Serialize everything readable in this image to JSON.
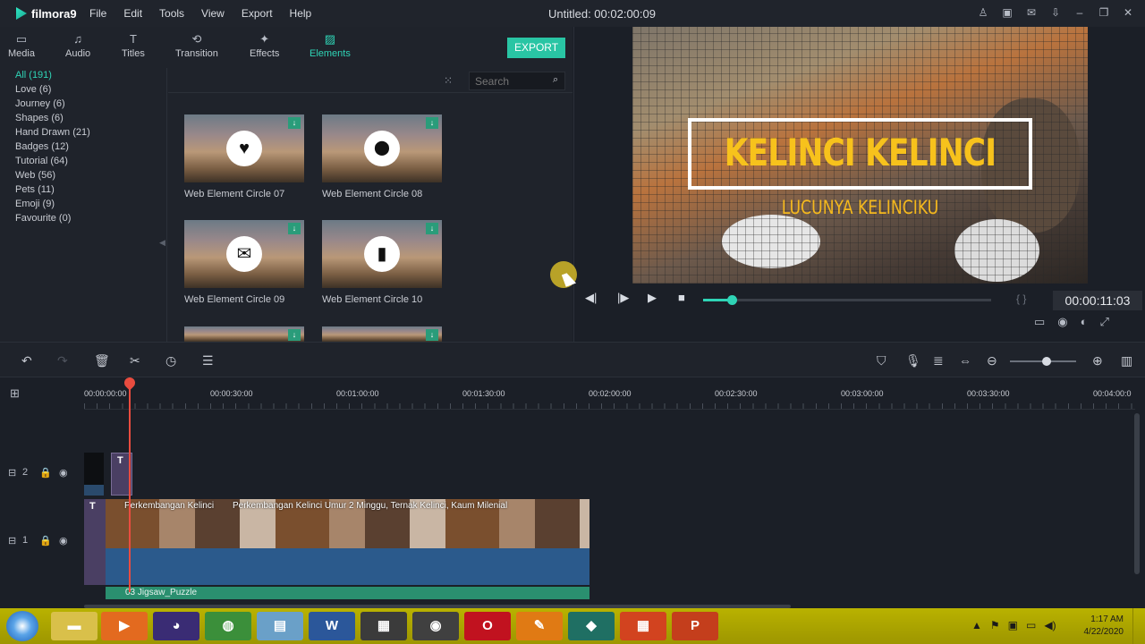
{
  "app": {
    "name": "filmora9",
    "menu": [
      "File",
      "Edit",
      "Tools",
      "View",
      "Export",
      "Help"
    ],
    "title": "Untitled:  00:02:00:09"
  },
  "tabs": [
    {
      "label": "Media",
      "icon": "folder-icon"
    },
    {
      "label": "Audio",
      "icon": "music-note-icon"
    },
    {
      "label": "Titles",
      "icon": "text-icon"
    },
    {
      "label": "Transition",
      "icon": "transition-icon"
    },
    {
      "label": "Effects",
      "icon": "effects-icon"
    },
    {
      "label": "Elements",
      "icon": "image-icon",
      "active": true
    }
  ],
  "export_label": "EXPORT",
  "categories": [
    "All (191)",
    "Love (6)",
    "Journey (6)",
    "Shapes (6)",
    "Hand Drawn (21)",
    "Badges (12)",
    "Tutorial (64)",
    "Web (56)",
    "Pets (11)",
    "Emoji (9)",
    "Favourite (0)"
  ],
  "search": {
    "placeholder": "Search"
  },
  "elements": [
    {
      "label": "Web Element Circle 07",
      "glyph": "♥",
      "icon": "heart-icon"
    },
    {
      "label": "Web Element Circle 08",
      "glyph": "⬤",
      "icon": "location-pin-icon"
    },
    {
      "label": "Web Element Circle 09",
      "glyph": "✉",
      "icon": "envelope-icon"
    },
    {
      "label": "Web Element Circle 10",
      "glyph": "▮",
      "icon": "phone-icon"
    }
  ],
  "preview": {
    "title": "KELINCI KELINCI",
    "subtitle": "LUCUNYA KELINCIKU",
    "timecode": "00:00:11:03",
    "progress": 0.1
  },
  "ruler": [
    "00:00:00:00",
    "00:00:30:00",
    "00:01:00:00",
    "00:01:30:00",
    "00:02:00:00",
    "00:02:30:00",
    "00:03:00:00",
    "00:03:30:00",
    "00:04:00:0"
  ],
  "tracks": {
    "track2": "2",
    "track1": "1",
    "title_clip": "T",
    "video_label_1": "Perkembangan Kelinci",
    "video_label_2": "Perkembangan Kelinci Umur 2 Minggu, Ternak Kelinci, Kaum Milenial",
    "music_label": "03 Jigsaw_Puzzle"
  },
  "zoom": 0.55,
  "taskbar": {
    "clock_time": "1:17 AM",
    "clock_date": "4/22/2020",
    "items": [
      "explorer",
      "media-player",
      "firefox",
      "chrome",
      "files",
      "word",
      "calendar",
      "eye",
      "opera",
      "sketch",
      "filmora",
      "office",
      "powerpoint"
    ]
  },
  "colors": {
    "accent": "#2fd4b6",
    "export": "#29c5a4",
    "playhead": "#e94c3f",
    "title_yellow": "#f7c21c"
  }
}
